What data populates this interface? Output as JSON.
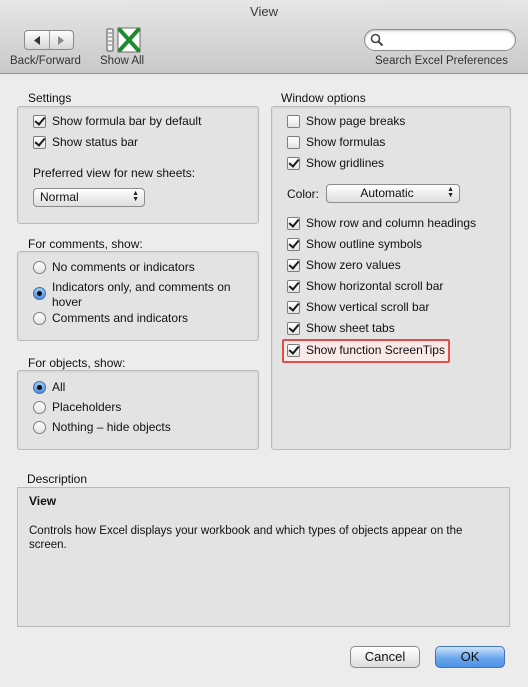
{
  "window": {
    "title": "View"
  },
  "toolbar": {
    "back_forward_label": "Back/Forward",
    "show_all_label": "Show All",
    "search_label": "Search Excel Preferences",
    "search_placeholder": ""
  },
  "settings": {
    "title": "Settings",
    "items": [
      {
        "label": "Show formula bar by default",
        "checked": true
      },
      {
        "label": "Show status bar",
        "checked": true
      }
    ],
    "preferred_view_label": "Preferred view for new sheets:",
    "preferred_view_value": "Normal"
  },
  "comments": {
    "title": "For comments, show:",
    "options": [
      {
        "label": "No comments or indicators",
        "selected": false
      },
      {
        "label": "Indicators only, and comments on",
        "label2": "hover",
        "selected": true
      },
      {
        "label": "Comments and indicators",
        "selected": false
      }
    ]
  },
  "objects": {
    "title": "For objects, show:",
    "options": [
      {
        "label": "All",
        "selected": true
      },
      {
        "label": "Placeholders",
        "selected": false
      },
      {
        "label": "Nothing – hide objects",
        "selected": false
      }
    ]
  },
  "window_options": {
    "title": "Window options",
    "items_top": [
      {
        "label": "Show page breaks",
        "checked": false
      },
      {
        "label": "Show formulas",
        "checked": false
      },
      {
        "label": "Show gridlines",
        "checked": true
      }
    ],
    "color_label": "Color:",
    "color_value": "Automatic",
    "items_bottom": [
      {
        "label": "Show row and column headings",
        "checked": true
      },
      {
        "label": "Show outline symbols",
        "checked": true
      },
      {
        "label": "Show zero values",
        "checked": true
      },
      {
        "label": "Show horizontal scroll bar",
        "checked": true
      },
      {
        "label": "Show vertical scroll bar",
        "checked": true
      },
      {
        "label": "Show sheet tabs",
        "checked": true
      },
      {
        "label": "Show function ScreenTips",
        "checked": true
      }
    ]
  },
  "description": {
    "title": "Description",
    "heading": "View",
    "text_line1": "Controls how Excel displays your workbook and which types of objects appear on the",
    "text_line2": "screen."
  },
  "buttons": {
    "cancel": "Cancel",
    "ok": "OK"
  },
  "colors": {
    "highlight_border": "#e0504a",
    "default_button": "#4d91e6",
    "excel_green": "#1e8c2e"
  }
}
